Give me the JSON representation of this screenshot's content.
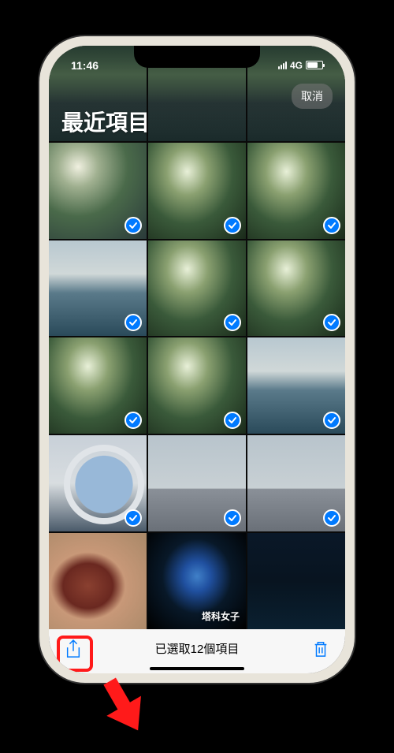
{
  "status": {
    "time": "11:46",
    "network": "4G"
  },
  "header": {
    "cancel_label": "取消",
    "album_title": "最近項目"
  },
  "grid": {
    "items": [
      {
        "kind": "river",
        "selected": false
      },
      {
        "kind": "river",
        "selected": false
      },
      {
        "kind": "river",
        "selected": false
      },
      {
        "kind": "bright-river",
        "selected": true
      },
      {
        "kind": "tree",
        "selected": true
      },
      {
        "kind": "tree",
        "selected": true
      },
      {
        "kind": "sky-river",
        "selected": true
      },
      {
        "kind": "tree",
        "selected": true
      },
      {
        "kind": "tree",
        "selected": true
      },
      {
        "kind": "tree",
        "selected": true
      },
      {
        "kind": "tree",
        "selected": true
      },
      {
        "kind": "sky-river",
        "selected": true
      },
      {
        "kind": "arch",
        "selected": true
      },
      {
        "kind": "building",
        "selected": true
      },
      {
        "kind": "building",
        "selected": true
      },
      {
        "kind": "food",
        "selected": false
      },
      {
        "kind": "night-tree",
        "selected": false,
        "watermark": "塔科女子"
      },
      {
        "kind": "night-city",
        "selected": false
      }
    ]
  },
  "toolbar": {
    "selected_text": "已選取12個項目"
  },
  "annotation": {
    "highlight_target": "share-button"
  }
}
